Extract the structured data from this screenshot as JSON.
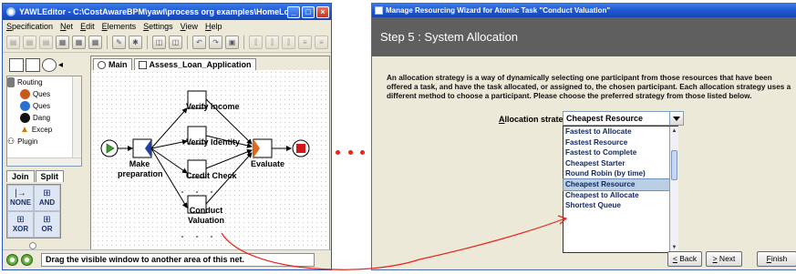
{
  "editor": {
    "title": "YAWLEditor - C:\\CostAwareBPM\\yawl\\process org examples\\HomeLoanProcess...",
    "window_buttons": [
      "_",
      "□",
      "×"
    ],
    "menu": [
      "Specification",
      "Net",
      "Edit",
      "Elements",
      "Settings",
      "View",
      "Help"
    ],
    "tree_items": [
      "Routing",
      "Ques",
      "Ques",
      "Dang",
      "Excep",
      "Plugin"
    ],
    "join_tab": "Join",
    "split_tab": "Split",
    "split_types": [
      {
        "glyph": "|→",
        "label": "NONE"
      },
      {
        "glyph": "⊞",
        "label": "AND"
      },
      {
        "glyph": "⊞",
        "label": "XOR"
      },
      {
        "glyph": "⊞",
        "label": "OR"
      }
    ],
    "net_tabs": [
      "Main",
      "Assess_Loan_Application"
    ],
    "tasks": {
      "make_preparation": "Make preparation",
      "verify_income": "Verify Income",
      "verify_identity": "Verify Identity",
      "credit_check": "Credit Check",
      "conduct_valuation": "Conduct Valuation",
      "evaluate": "Evaluate"
    },
    "status_text": "Drag the visible window to another area of this net."
  },
  "wizard": {
    "title": "Manage Resourcing Wizard for Atomic Task \"Conduct Valuation\"",
    "step_title": "Step 5 : System Allocation",
    "description": "An allocation strategy is a way of dynamically selecting one participant from those resources that have been offered a task, and have the task allocated, or assigned to, the chosen participant. Each allocation strategy uses a different method to choose a participant. Please choose the preferred strategy from those listed below.",
    "strategy_label": "Allocation strategy:",
    "selected_strategy": "Cheapest Resource",
    "options": [
      "Fastest to Allocate",
      "Fastest Resource",
      "Fastest to Complete",
      "Cheapest Starter",
      "Round Robin (by time)",
      "Cheapest Resource",
      "Cheapest to Allocate",
      "Shortest Queue"
    ],
    "selected_index": 5,
    "back_label": "< Back",
    "next_label": "> Next",
    "finish_label": "Finish"
  },
  "colors": {
    "annotation": "#e8241b",
    "titlebar": "#1d55d0",
    "stepbar": "#5f5f5f",
    "split_marker": "#1d3fa6",
    "join_marker": "#e06a1b"
  }
}
